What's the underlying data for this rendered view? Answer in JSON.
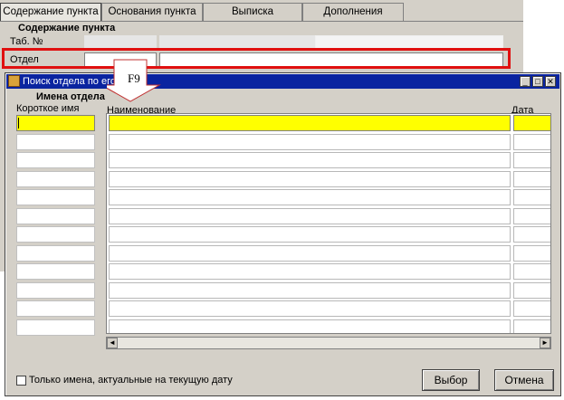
{
  "tabs": [
    {
      "label": "Содержание пункта",
      "active": true
    },
    {
      "label": "Основания пункта",
      "active": false
    },
    {
      "label": "Выписка",
      "active": false
    },
    {
      "label": "Дополнения",
      "active": false
    }
  ],
  "form": {
    "section_title": "Содержание пункта",
    "tab_no_label": "Таб. №",
    "dept_label": "Отдел"
  },
  "callout": {
    "label": "F9"
  },
  "dialog": {
    "title": "Поиск отдела по его",
    "names_section": "Имена отдела",
    "col_short_name": "Короткое имя",
    "col_name": "Наименование",
    "col_date": "Дата",
    "checkbox_label": "Только имена, актуальные на текущую дату",
    "checkbox_checked": false,
    "ok_button": "Выбор",
    "cancel_button": "Отмена",
    "left_rows": 12,
    "grid_rows": 12
  },
  "colors": {
    "selection": "#ffff00",
    "highlight_border": "#e01010",
    "titlebar": "#0a24a0",
    "window_bg": "#d4d0c8"
  },
  "icons": [
    "app-icon",
    "minimize-icon",
    "maximize-icon",
    "close-icon",
    "scroll-left-icon",
    "scroll-right-icon"
  ]
}
